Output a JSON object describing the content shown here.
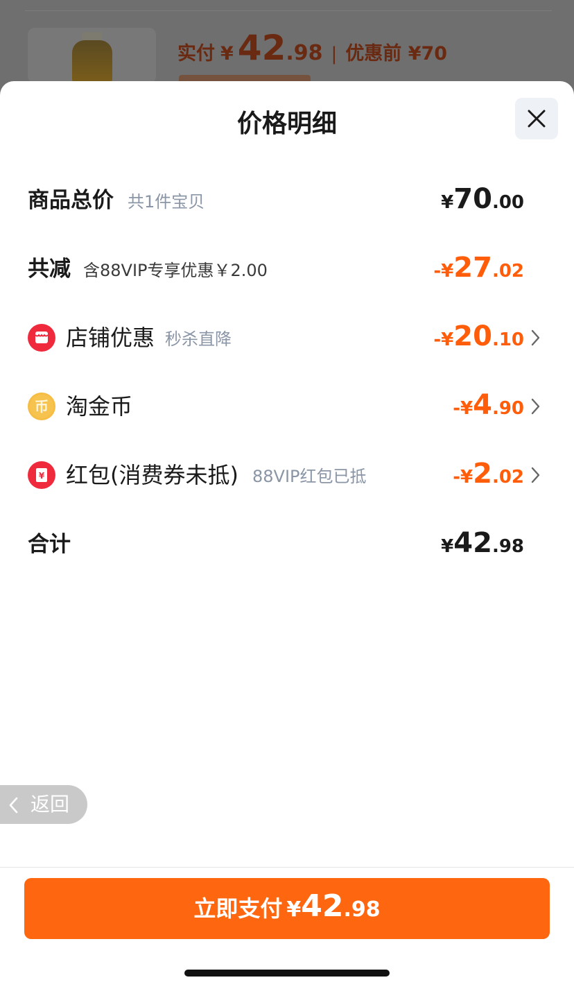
{
  "background_card": {
    "paid_label": "实付",
    "yen": "¥",
    "paid_int": "42",
    "paid_dec": ".98",
    "separator": "|",
    "before_discount": "优惠前 ¥70"
  },
  "sheet": {
    "title": "价格明细",
    "close_icon": "close-icon"
  },
  "rows": {
    "subtotal": {
      "label": "商品总价",
      "sub": "共1件宝贝",
      "yen": "¥",
      "int": "70",
      "dec": ".00"
    },
    "discount_total": {
      "label": "共减",
      "sub": "含88VIP专享优惠￥2.00",
      "minus": "-",
      "yen": "¥",
      "int": "27",
      "dec": ".02"
    },
    "store_discount": {
      "label": "店铺优惠",
      "sub": "秒杀直降",
      "minus": "-",
      "yen": "¥",
      "int": "20",
      "dec": ".10",
      "icon": "store-icon"
    },
    "taojin_coin": {
      "label": "淘金币",
      "minus": "-",
      "yen": "¥",
      "int": "4",
      "dec": ".90",
      "icon": "coin-icon",
      "icon_glyph": "币"
    },
    "red_packet": {
      "label": "红包(消费券未抵)",
      "sub": "88VIP红包已抵",
      "minus": "-",
      "yen": "¥",
      "int": "2",
      "dec": ".02",
      "icon": "red-packet-icon",
      "icon_glyph": "¥"
    },
    "total": {
      "label": "合计",
      "yen": "¥",
      "int": "42",
      "dec": ".98"
    }
  },
  "back_button": {
    "label": "返回",
    "icon": "chevron-left-icon"
  },
  "pay_button": {
    "label": "立即支付",
    "yen": "¥",
    "int": "42",
    "dec": ".98"
  },
  "colors": {
    "accent": "#fe6710",
    "discount": "#ff5d0a",
    "store_icon": "#f02a3d",
    "coin_icon": "#f7c34f"
  }
}
